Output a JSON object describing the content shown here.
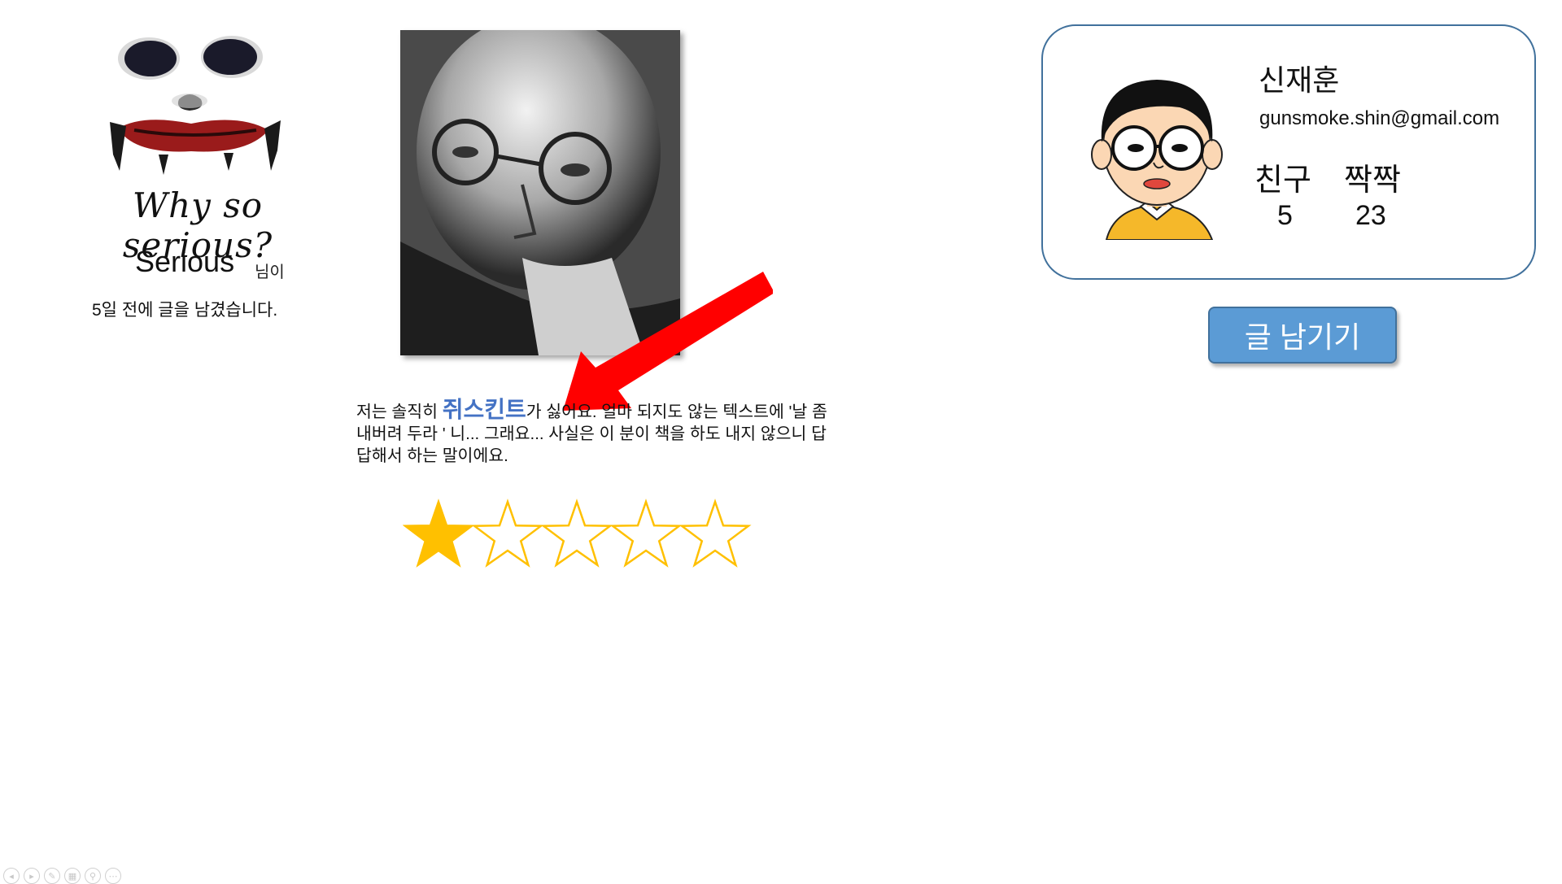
{
  "poster": {
    "tagline": "Why so serious?",
    "name": "Serious",
    "name_suffix": "님이",
    "posted_time": "5일 전에 글을 남겼습니다."
  },
  "review": {
    "text_before": "저는 솔직히 ",
    "highlight": "쥐스킨트",
    "text_after": "가 싫어요. 얼마 되지도 않는 텍스트에 '날 좀 내버려 두라 ' 니... 그래요... 사실은 이 분이 책을 하도 내지 않으니 답답해서 하는 말이에요.",
    "rating": 1,
    "rating_max": 5
  },
  "profile": {
    "name": "신재훈",
    "email": "gunsmoke.shin@gmail.com",
    "friends_label": "친구",
    "friends_count": "5",
    "jjak_label": "짝짝",
    "jjak_count": "23"
  },
  "actions": {
    "write_label": "글 남기기"
  },
  "colors": {
    "accent_blue": "#5b9bd5",
    "border_blue": "#41719c",
    "highlight_blue": "#4472c4",
    "star_gold": "#ffc000",
    "arrow_red": "#ff0000"
  },
  "toolbar": {
    "icons": [
      "prev-icon",
      "next-icon",
      "pen-icon",
      "slides-icon",
      "zoom-icon",
      "more-icon"
    ]
  }
}
